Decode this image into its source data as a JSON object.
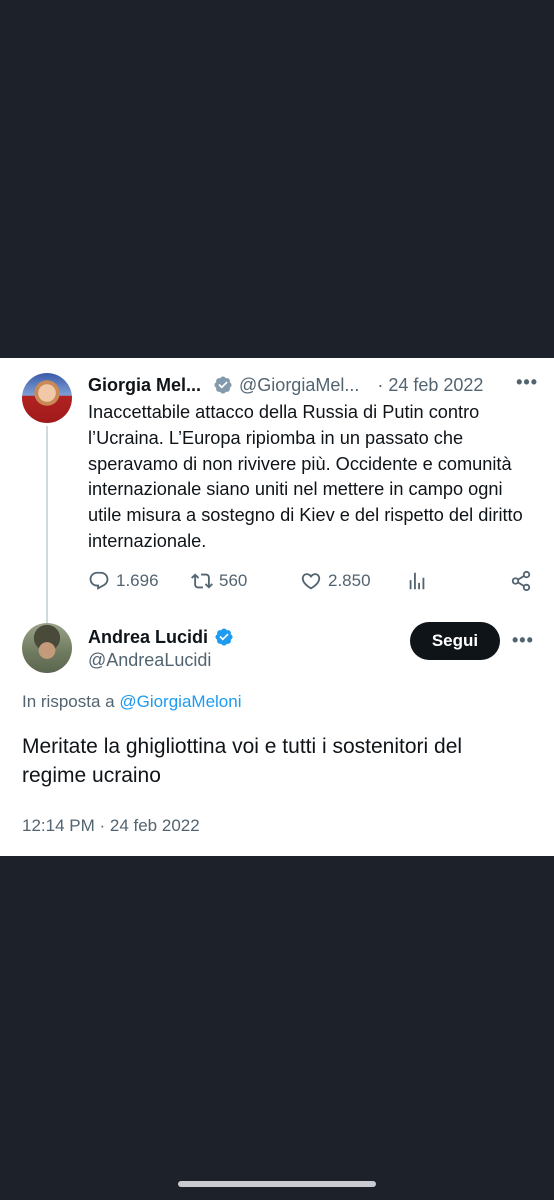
{
  "parent_tweet": {
    "name": "Giorgia Mel...",
    "handle": "@GiorgiaMel...",
    "date": "· 24 feb 2022",
    "more": "•••",
    "text": "Inaccettabile attacco della Russia di Putin contro l’Ucraina. L’Europa ripiomba in un passato che speravamo di non rivivere più. Occidente e comunità internazionale siano uniti nel mettere in campo ogni utile misura a sostegno di Kiev e del rispetto del diritto internazionale.",
    "actions": {
      "replies": "1.696",
      "retweets": "560",
      "likes": "2.850"
    }
  },
  "reply_tweet": {
    "name": "Andrea Lucidi",
    "handle": "@AndreaLucidi",
    "follow_label": "Segui",
    "more": "•••",
    "reply_prefix": "In risposta a",
    "reply_to": "@GiorgiaMeloni",
    "text": "Meritate la ghigliottina voi e tutti i sostenitori del regime ucraino",
    "timestamp": "12:14 PM · 24 feb 2022"
  },
  "colors": {
    "background": "#1d2129",
    "accent_blue": "#1d9bf0",
    "secondary_text": "#536471",
    "verified_gray": "#829aab"
  }
}
